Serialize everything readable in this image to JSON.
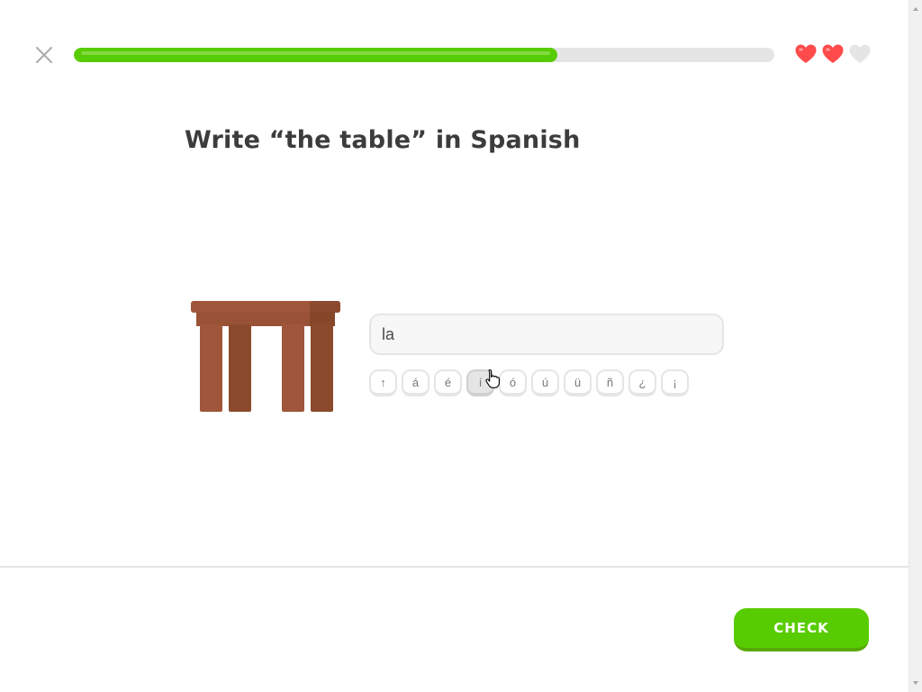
{
  "header": {
    "close_icon": "close-icon",
    "progress": 0.69,
    "progress_color": "#58cc02",
    "hearts": [
      {
        "state": "full",
        "color": "#ff4b4b"
      },
      {
        "state": "full",
        "color": "#ff4b4b"
      },
      {
        "state": "empty",
        "color": "#e5e5e5"
      }
    ]
  },
  "challenge": {
    "prompt": "Write “the table” in Spanish",
    "illustration": "table-illustration",
    "answer_value": "la",
    "special_chars": [
      {
        "label": "↑",
        "name": "shift"
      },
      {
        "label": "á",
        "name": "a-acute"
      },
      {
        "label": "é",
        "name": "e-acute"
      },
      {
        "label": "í",
        "name": "i-acute",
        "active": true
      },
      {
        "label": "ó",
        "name": "o-acute"
      },
      {
        "label": "ú",
        "name": "u-acute"
      },
      {
        "label": "ü",
        "name": "u-umlaut"
      },
      {
        "label": "ñ",
        "name": "n-tilde"
      },
      {
        "label": "¿",
        "name": "inverted-question"
      },
      {
        "label": "¡",
        "name": "inverted-exclamation"
      }
    ]
  },
  "footer": {
    "check_label": "CHECK",
    "check_color": "#58cc02"
  }
}
